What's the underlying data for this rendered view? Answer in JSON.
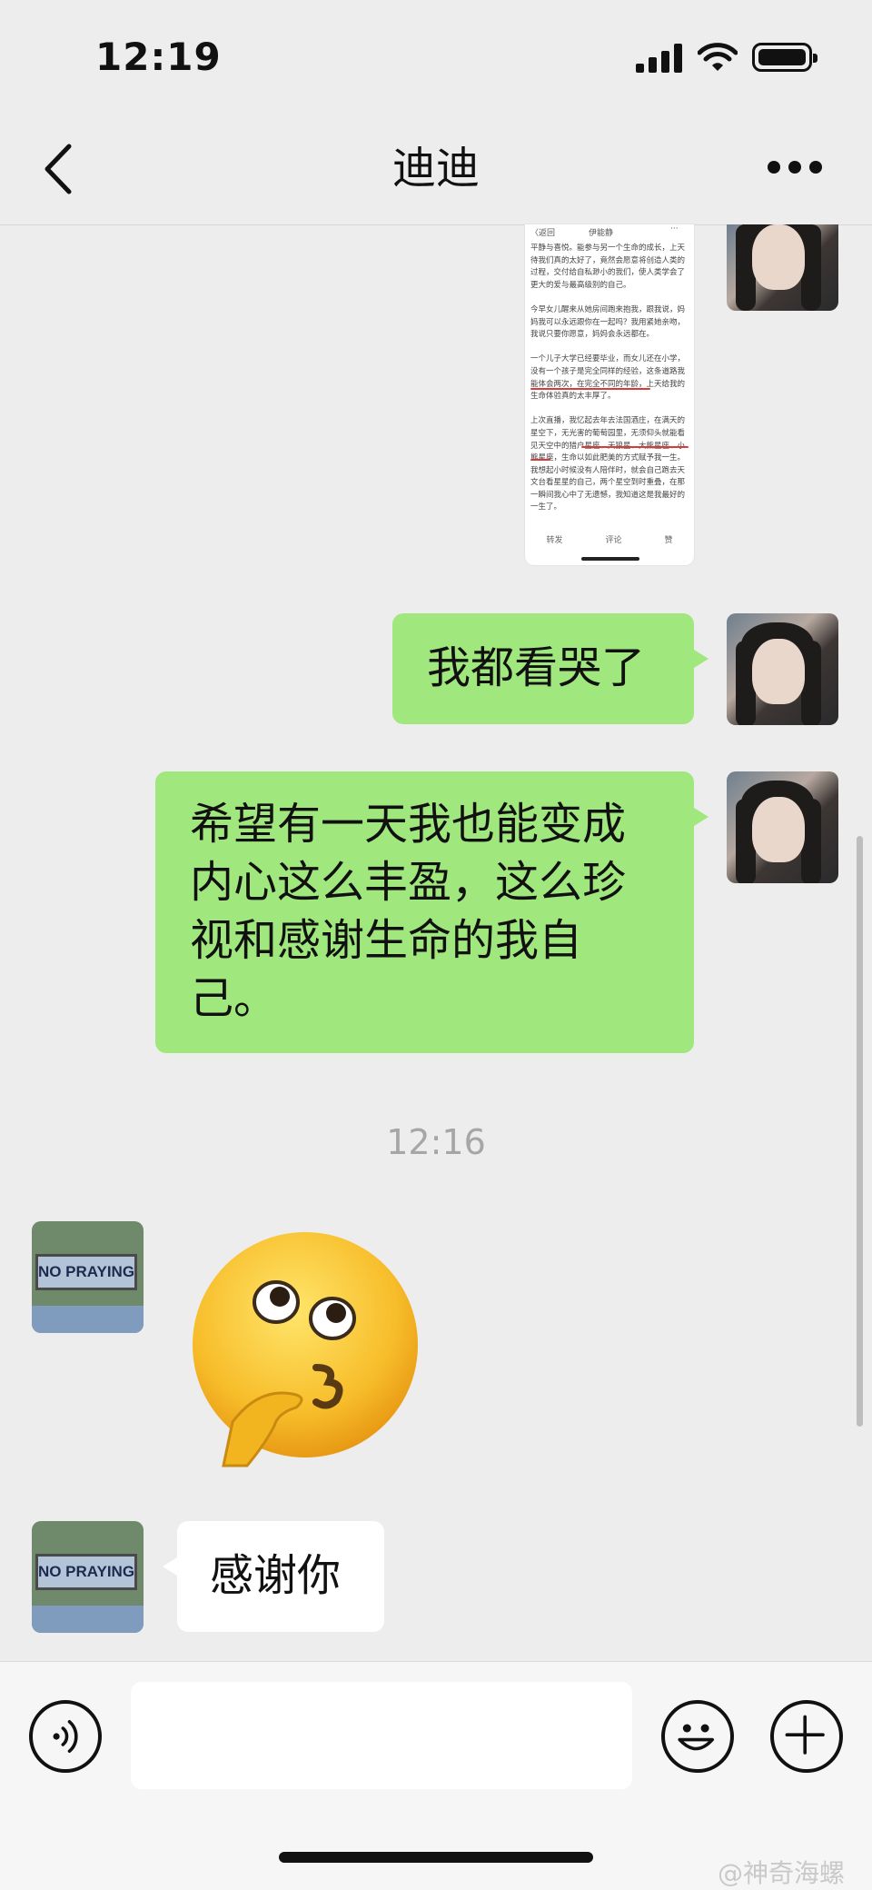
{
  "status_bar": {
    "time": "12:19"
  },
  "nav": {
    "title": "迪迪"
  },
  "shared_screenshot": {
    "header_back": "〈返回",
    "header_name": "伊能静",
    "header_more": "···",
    "body": "平静与喜悦。能参与另一个生命的成长，上天待我们真的太好了，竟然会愿意将创造人类的过程，交付给自私渺小的我们，使人类学会了更大的爱与最高级别的自己。\n\n今早女儿醒来从她房间跑来抱我，跟我说，妈妈我可以永远跟你在一起吗？我用紧她亲吻，我说只要你愿意，妈妈会永远都在。\n\n一个儿子大学已经要毕业，而女儿还在小学，没有一个孩子是完全同样的经验，这条道路我能体会两次，在完全不同的年龄，上天给我的生命体验真的太丰厚了。\n\n上次直播，我忆起去年去法国酒庄，在满天的星空下，无光害的葡萄园里，无须仰头就能看见天空中的猎户星座、天狼星、大熊星座、小熊星座，生命以如此肥美的方式赋予我一生。我想起小时候没有人陪伴时，就会自己跑去天文台看星星的自己，两个星空到时重叠，在那一瞬间我心中了无遗憾，我知道这是我最好的一生了。",
    "footer": [
      "转发",
      "评论",
      "赞"
    ]
  },
  "messages": [
    {
      "side": "right",
      "type": "text",
      "text": "我都看哭了"
    },
    {
      "side": "right",
      "type": "text",
      "text": "希望有一天我也能变成内心这么丰盈，这么珍视和感谢生命的我自己。"
    },
    {
      "type": "timestamp",
      "text": "12:16"
    },
    {
      "side": "left",
      "type": "emoji",
      "name": "thinking-whistle-emoji"
    },
    {
      "side": "left",
      "type": "text",
      "text": "感谢你"
    }
  ],
  "avatars": {
    "self": "girl-portrait",
    "contact_sign_text": "NO PRAYING"
  },
  "input_bar": {
    "placeholder": ""
  },
  "watermark": "@神奇海螺"
}
